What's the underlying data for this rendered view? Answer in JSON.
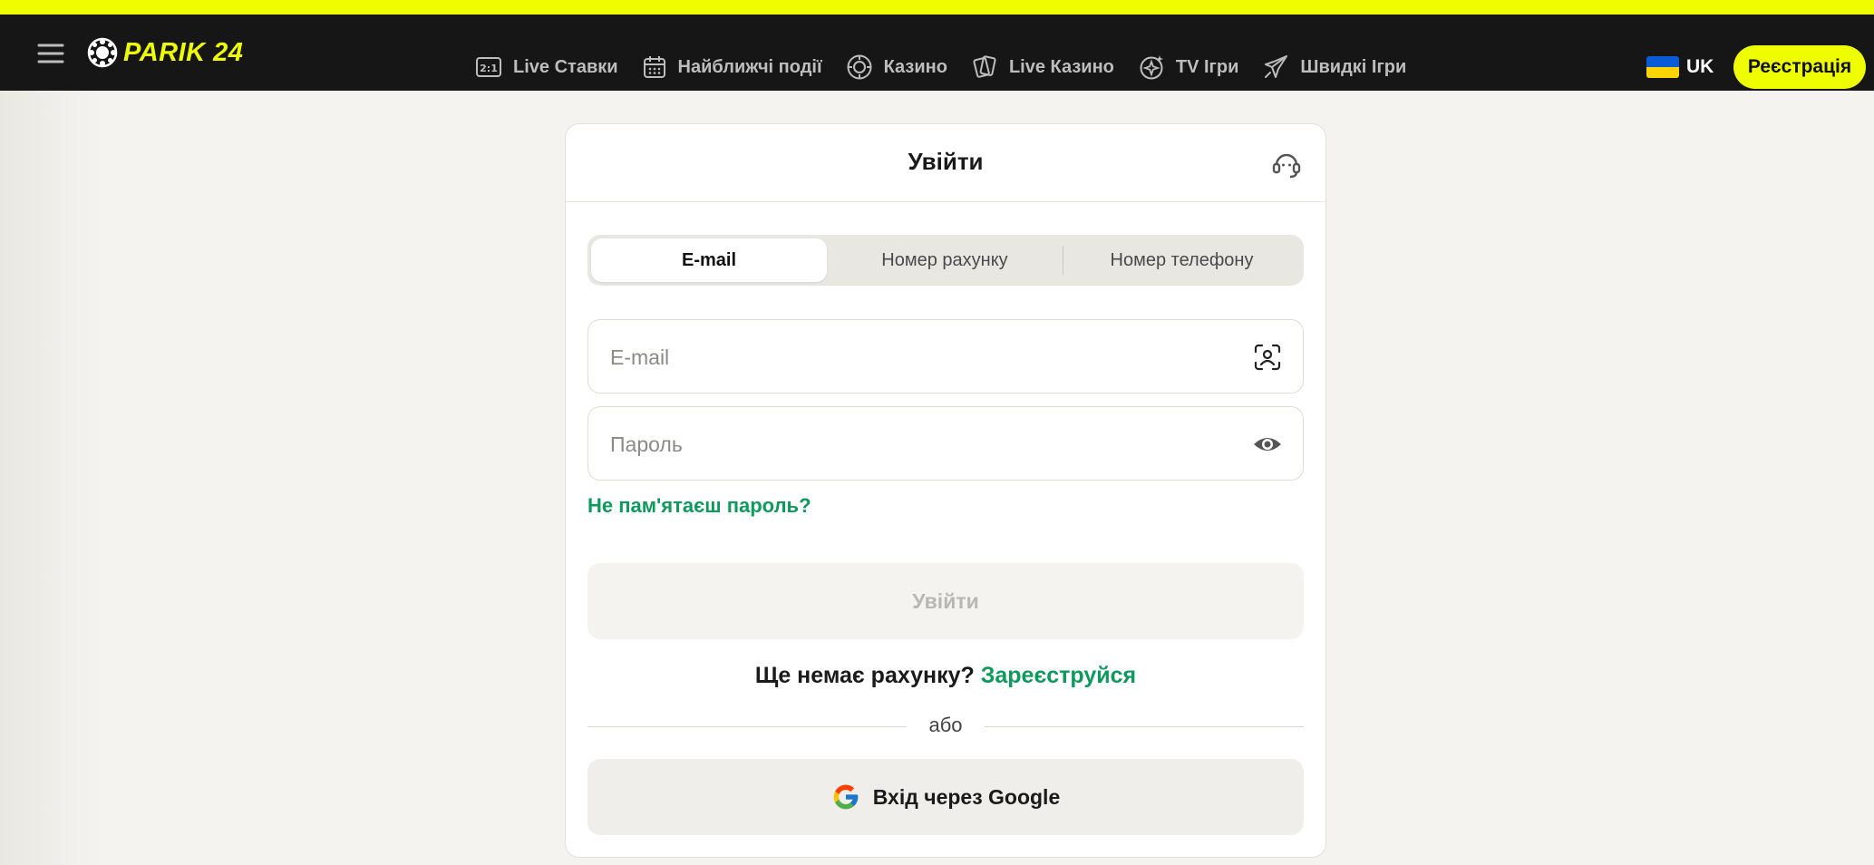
{
  "header": {
    "logo_text": "PARIK 24",
    "nav": [
      {
        "label": "Live Ставки",
        "icon": "live-bets-icon"
      },
      {
        "label": "Найближчі події",
        "icon": "calendar-icon"
      },
      {
        "label": "Казино",
        "icon": "casino-chip-icon"
      },
      {
        "label": "Live Казино",
        "icon": "cards-icon"
      },
      {
        "label": "TV Ігри",
        "icon": "sparkle-icon"
      },
      {
        "label": "Швидкі Ігри",
        "icon": "rocket-icon"
      }
    ],
    "language": "UK",
    "register_label": "Реєстрація"
  },
  "login": {
    "title": "Увійти",
    "tabs": [
      "E-mail",
      "Номер рахунку",
      "Номер телефону"
    ],
    "active_tab": 0,
    "email_placeholder": "E-mail",
    "password_placeholder": "Пароль",
    "forgot_label": "Не пам'ятаєш пароль?",
    "submit_label": "Увійти",
    "no_account_text": "Ще немає рахунку?",
    "register_link": "Зареєструйся",
    "or_text": "або",
    "google_label": "Вхід через Google"
  },
  "colors": {
    "accent_yellow": "#eefd00",
    "link_green": "#0e9a5c",
    "navbar_bg": "#161616"
  }
}
